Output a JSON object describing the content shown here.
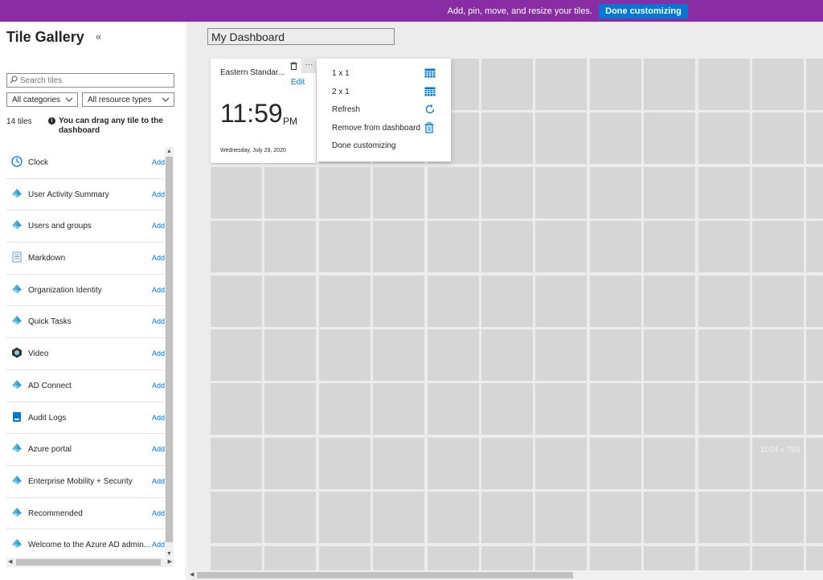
{
  "banner": {
    "message": "Add, pin, move, and resize your tiles.",
    "done_button": "Done customizing"
  },
  "gallery": {
    "title": "Tile Gallery",
    "collapse_glyph": "«",
    "search_placeholder": "Search tiles",
    "category_filter": "All categories",
    "resource_filter": "All resource types",
    "tile_count": "14 tiles",
    "drag_hint": "You can drag any tile to the dashboard",
    "add_label": "Add",
    "tiles": [
      {
        "name": "Clock",
        "icon": "clock-icon"
      },
      {
        "name": "User Activity Summary",
        "icon": "azure-ad-icon"
      },
      {
        "name": "Users and groups",
        "icon": "azure-ad-icon"
      },
      {
        "name": "Markdown",
        "icon": "document-icon"
      },
      {
        "name": "Organization Identity",
        "icon": "azure-ad-icon"
      },
      {
        "name": "Quick Tasks",
        "icon": "azure-ad-icon"
      },
      {
        "name": "Video",
        "icon": "video-icon"
      },
      {
        "name": "AD Connect",
        "icon": "azure-ad-icon"
      },
      {
        "name": "Audit Logs",
        "icon": "book-icon"
      },
      {
        "name": "Azure portal",
        "icon": "azure-ad-icon"
      },
      {
        "name": "Enterprise Mobility + Security",
        "icon": "azure-ad-icon"
      },
      {
        "name": "Recommended",
        "icon": "azure-ad-icon"
      },
      {
        "name": "Welcome to the Azure AD admin...",
        "icon": "azure-ad-icon"
      }
    ]
  },
  "dashboard": {
    "name": "My Dashboard",
    "grid_dimensions_label": "1024 x 768",
    "clock_tile": {
      "timezone": "Eastern Standar...",
      "edit_label": "Edit",
      "time": "11:59",
      "ampm": "PM",
      "date": "Wednesday, July 29, 2020"
    },
    "more_button": "···",
    "context_menu": [
      {
        "label": "1 x 1",
        "icon": "grid-1x1-icon"
      },
      {
        "label": "2 x 1",
        "icon": "grid-2x1-icon"
      },
      {
        "label": "Refresh",
        "icon": "refresh-icon"
      },
      {
        "label": "Remove from dashboard",
        "icon": "trash-icon"
      },
      {
        "label": "Done customizing",
        "icon": ""
      }
    ]
  },
  "colors": {
    "banner": "#8a2da5",
    "accent": "#0078d4",
    "grid_cell": "#d6d6d6",
    "canvas": "#ececec"
  }
}
